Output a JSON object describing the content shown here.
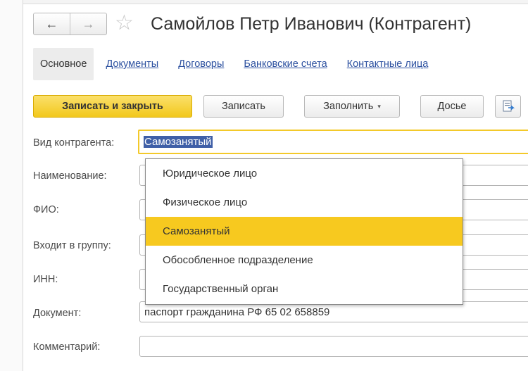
{
  "window": {
    "title": "Самойлов Петр Иванович (Контрагент)",
    "back_symbol": "←",
    "forward_symbol": "→",
    "star_symbol": "☆"
  },
  "tabs": [
    {
      "label": "Основное",
      "active": true
    },
    {
      "label": "Документы",
      "active": false
    },
    {
      "label": "Договоры",
      "active": false
    },
    {
      "label": "Банковские счета",
      "active": false
    },
    {
      "label": "Контактные лица",
      "active": false
    }
  ],
  "toolbar": {
    "save_close_label": "Записать и закрыть",
    "save_label": "Записать",
    "fill_label": "Заполнить",
    "fill_caret": "▾",
    "dossier_label": "Досье"
  },
  "form": {
    "type_label": "Вид контрагента:",
    "type_value": "Самозанятый",
    "name_label": "Наименование:",
    "fio_label": "ФИО:",
    "group_label": "Входит в группу:",
    "inn_label": "ИНН:",
    "document_label": "Документ:",
    "document_value": "паспорт гражданина РФ 65 02 658859",
    "comment_label": "Комментарий:",
    "comment_value": ""
  },
  "dropdown": {
    "options": [
      {
        "label": "Юридическое лицо",
        "selected": false
      },
      {
        "label": "Физическое лицо",
        "selected": false
      },
      {
        "label": "Самозанятый",
        "selected": true
      },
      {
        "label": "Обособленное подразделение",
        "selected": false
      },
      {
        "label": "Государственный орган",
        "selected": false
      }
    ]
  },
  "colors": {
    "accent": "#f7c91f",
    "link": "#2d51a0",
    "selection": "#3f5fa7"
  }
}
